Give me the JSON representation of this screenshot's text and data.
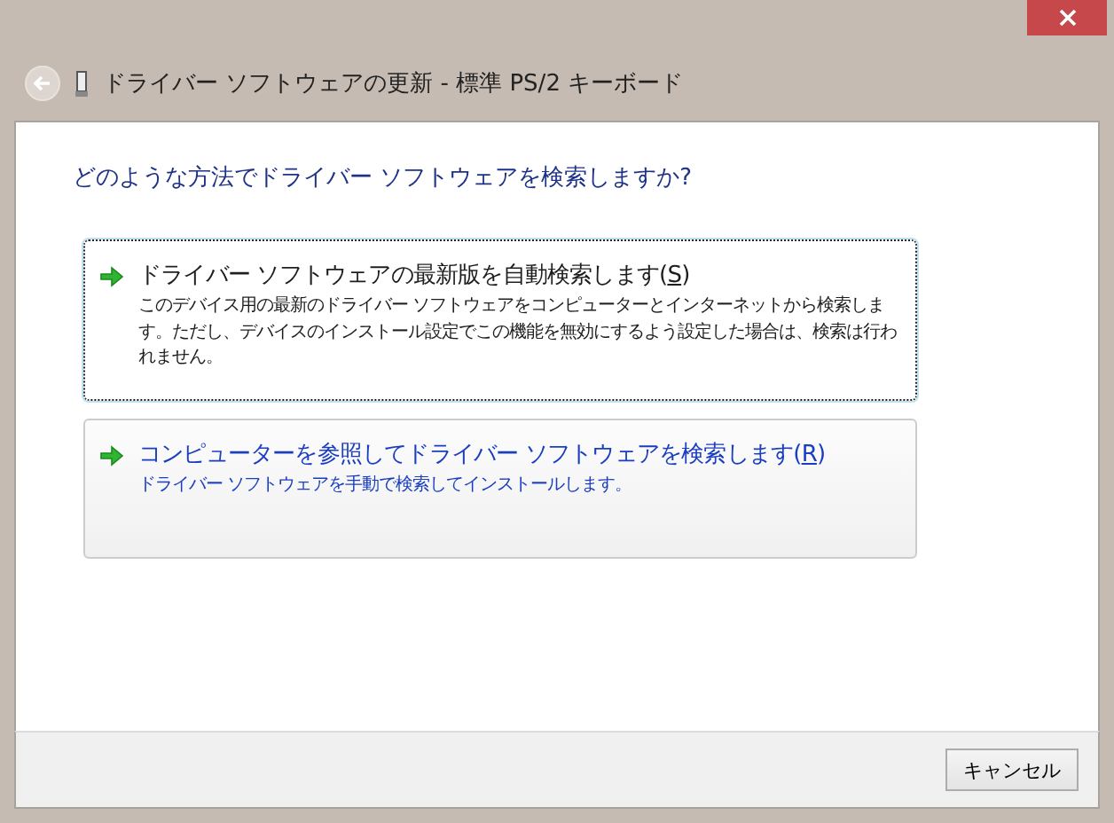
{
  "window": {
    "title": "ドライバー ソフトウェアの更新 - 標準 PS/2 キーボード"
  },
  "question": "どのような方法でドライバー ソフトウェアを検索しますか?",
  "options": [
    {
      "title_before": "ドライバー ソフトウェアの最新版を自動検索します(",
      "access_key": "S",
      "title_after": ")",
      "description": "このデバイス用の最新のドライバー ソフトウェアをコンピューターとインターネットから検索します。ただし、デバイスのインストール設定でこの機能を無効にするよう設定した場合は、検索は行われません。",
      "selected": true
    },
    {
      "title_before": "コンピューターを参照してドライバー ソフトウェアを検索します(",
      "access_key": "R",
      "title_after": ")",
      "description": "ドライバー ソフトウェアを手動で検索してインストールします。",
      "selected": false
    }
  ],
  "buttons": [
    "キャンセル"
  ]
}
